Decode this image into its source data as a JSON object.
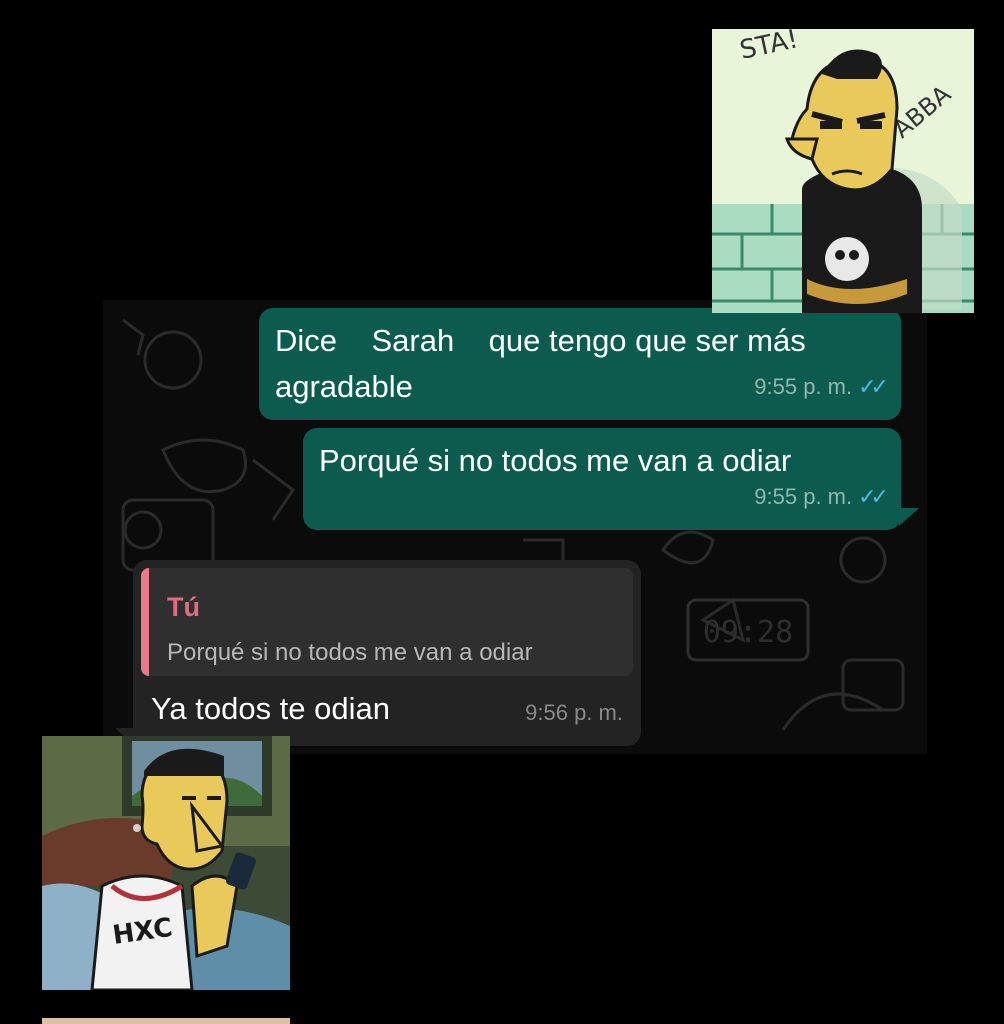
{
  "messages": [
    {
      "text": "Dice    Sarah    que tengo que ser más\nagradable",
      "time": "9:55 p. m.",
      "direction": "outgoing",
      "status": "read-check-icon"
    },
    {
      "text": "Porqué si no todos me van a odiar",
      "time": "9:55 p. m.",
      "direction": "outgoing",
      "status": "read-check-icon"
    },
    {
      "text": "Ya todos te odian",
      "time": "9:56 p. m.",
      "direction": "incoming",
      "quote": {
        "author": "Tú",
        "text": "Porqué si no todos me van a odiar"
      }
    }
  ],
  "colors": {
    "outgoing_bubble": "#0b5c4f",
    "incoming_bubble": "#232323",
    "quote_accent": "#e46a7f",
    "tick_read": "#4fb6ec"
  },
  "illustration_text": {
    "wall_graffiti": [
      "STA!",
      "ABBA"
    ],
    "shirt_print": "HXC"
  },
  "background_doodle_clock": "09:28"
}
